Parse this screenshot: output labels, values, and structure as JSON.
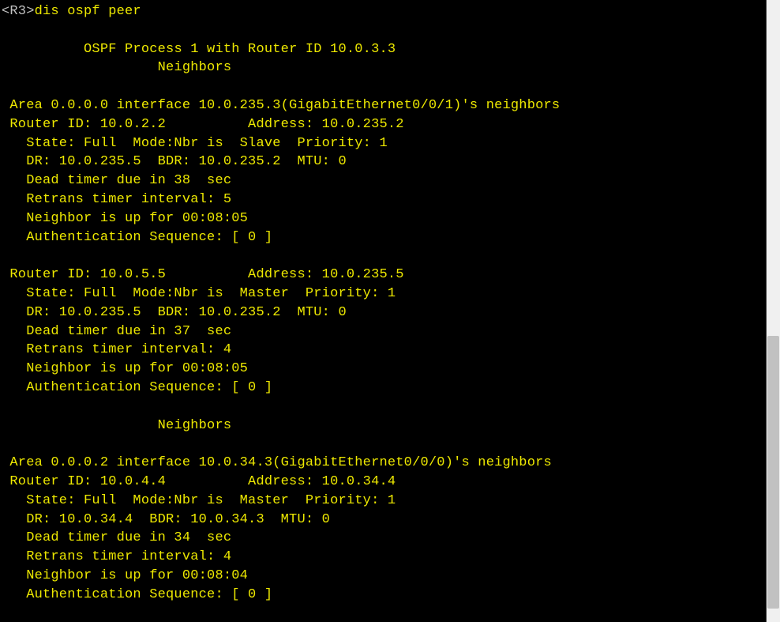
{
  "prompt": {
    "host": "<R3>",
    "command": "dis ospf peer"
  },
  "header": {
    "process_line": "\t  OSPF Process 1 with Router ID 10.0.3.3",
    "neighbors_label_1": "\t\t   Neighbors",
    "neighbors_label_2": "\t\t   Neighbors"
  },
  "area0": {
    "iface_line": " Area 0.0.0.0 interface 10.0.235.3(GigabitEthernet0/0/1)'s neighbors",
    "peers": [
      {
        "rid_addr": " Router ID: 10.0.2.2          Address: 10.0.235.2",
        "state": "   State: Full  Mode:Nbr is  Slave  Priority: 1",
        "dr": "   DR: 10.0.235.5  BDR: 10.0.235.2  MTU: 0",
        "dead": "   Dead timer due in 38  sec",
        "retrans": "   Retrans timer interval: 5",
        "uptime": "   Neighbor is up for 00:08:05",
        "auth": "   Authentication Sequence: [ 0 ]"
      },
      {
        "rid_addr": " Router ID: 10.0.5.5          Address: 10.0.235.5",
        "state": "   State: Full  Mode:Nbr is  Master  Priority: 1",
        "dr": "   DR: 10.0.235.5  BDR: 10.0.235.2  MTU: 0",
        "dead": "   Dead timer due in 37  sec",
        "retrans": "   Retrans timer interval: 4",
        "uptime": "   Neighbor is up for 00:08:05",
        "auth": "   Authentication Sequence: [ 0 ]"
      }
    ]
  },
  "area2": {
    "iface_line": " Area 0.0.0.2 interface 10.0.34.3(GigabitEthernet0/0/0)'s neighbors",
    "peers": [
      {
        "rid_addr": " Router ID: 10.0.4.4          Address: 10.0.34.4",
        "state": "   State: Full  Mode:Nbr is  Master  Priority: 1",
        "dr": "   DR: 10.0.34.4  BDR: 10.0.34.3  MTU: 0",
        "dead": "   Dead timer due in 34  sec",
        "retrans": "   Retrans timer interval: 4",
        "uptime": "   Neighbor is up for 00:08:04",
        "auth": "   Authentication Sequence: [ 0 ]"
      }
    ]
  }
}
